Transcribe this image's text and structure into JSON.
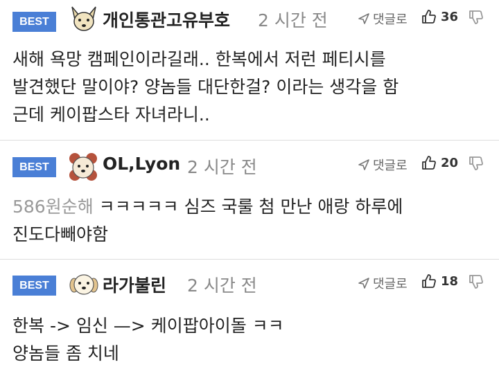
{
  "comments": [
    {
      "badge": "BEST",
      "nickname": "개인통관고유부호",
      "time": "2 시간 전",
      "reply_label": "댓글로",
      "likes": "36",
      "body_lines": [
        "새해 욕망 캠페인이라길래.. 한복에서 저런 페티시를",
        "발견했단 말이야? 양놈들 대단한걸? 이라는 생각을 함",
        "근데 케이팝스타 자녀라니.."
      ]
    },
    {
      "badge": "BEST",
      "nickname": "OL,Lyon",
      "time": "2 시간 전",
      "reply_label": "댓글로",
      "likes": "20",
      "quote": "586원순해",
      "body_first": " ㅋㅋㅋㅋㅋ 심즈 국룰 첨 만난 애랑 하루에",
      "body_second": "진도다빼야함"
    },
    {
      "badge": "BEST",
      "nickname": "라가불린",
      "time": "2 시간 전",
      "reply_label": "댓글로",
      "likes": "18",
      "body_lines": [
        "한복 -> 임신 —> 케이팝아이돌 ㅋㅋ",
        "양놈들 좀 치네"
      ]
    }
  ]
}
